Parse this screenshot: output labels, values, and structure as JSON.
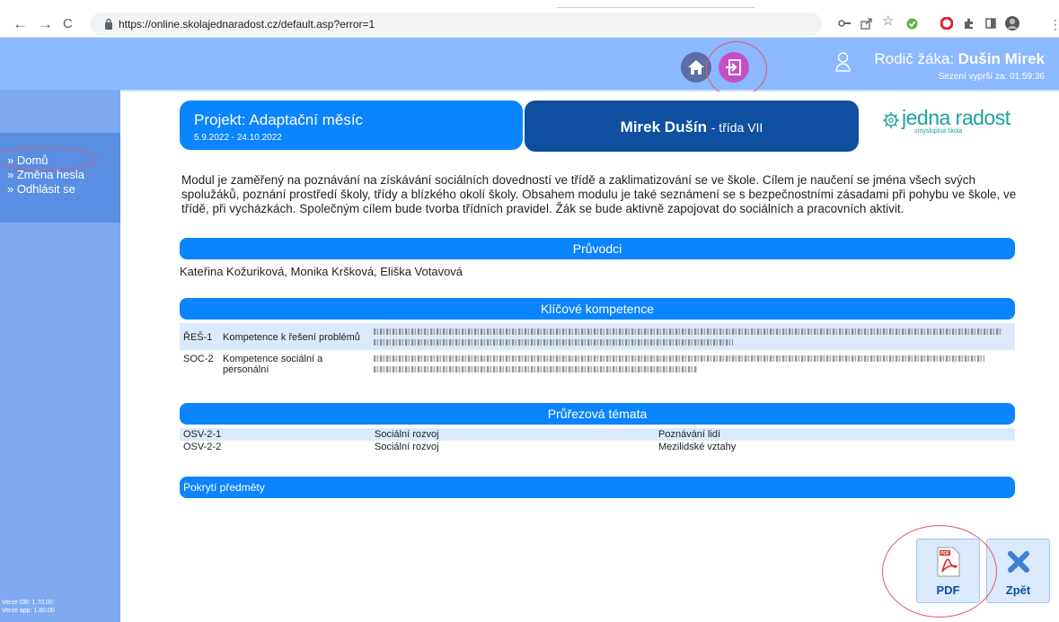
{
  "browser": {
    "url": "https://online.skolajednaradost.cz/default.asp?error=1",
    "back": "←",
    "forward": "→",
    "reload": "C"
  },
  "header": {
    "role_label": "Rodič žáka:",
    "user_name": "Dušin Mirek",
    "session": "Sezení vyprší za: 01:59:36"
  },
  "sidebar": {
    "items": [
      {
        "label": "» Domů"
      },
      {
        "label": "» Změna hesla"
      },
      {
        "label": "» Odhlásit se"
      }
    ],
    "version_db": "Verze DB: 1.70.00",
    "version_app": "Verze app: 1.80.00"
  },
  "project": {
    "title": "Projekt: Adaptační měsíc",
    "dates": "5.9.2022 - 24.10.2022"
  },
  "student": {
    "name": "Mirek Dušín",
    "class": "- třída VII"
  },
  "logo": {
    "name": "jedna radost",
    "tagline": "smysluplná škola"
  },
  "description": "Modul je zaměřený na poznávání na získávání sociálních dovedností ve třídě a zaklimatizování se ve škole. Cílem je naučení se jména všech svých spolužáků, poznání prostředí školy, třídy a blízkého okolí školy. Obsahem modulu je také seznámení se s bezpečnostními zásadami při pohybu ve škole, ve třídě, při vycházkách. Společným cílem bude tvorba třídních pravidel. Žák se bude aktivně zapojovat do sociálních a pracovních aktivit.",
  "guides": {
    "heading": "Průvodci",
    "names": "Kateřina Kožuriková, Monika Kršková, Eliška Votavová"
  },
  "competences": {
    "heading": "Klíčové kompetence",
    "rows": [
      {
        "code": "ŘEŠ-1",
        "name": "Kompetence k řešení problémů"
      },
      {
        "code": "SOC-2",
        "name": "Kompetence sociální a personální"
      }
    ]
  },
  "themes": {
    "heading": "Průřezová témata",
    "rows": [
      {
        "code": "OSV-2-1",
        "area": "Sociální rozvoj",
        "topic": "Poznávání lidí"
      },
      {
        "code": "OSV-2-2",
        "area": "Sociální rozvoj",
        "topic": "Mezilidské vztahy"
      }
    ]
  },
  "subjects": {
    "heading": "Pokrytí předměty"
  },
  "actions": {
    "pdf": "PDF",
    "back": "Zpět",
    "pdf_icon_text": "PDF"
  },
  "colors": {
    "primary": "#0a84ff",
    "dark": "#0f4fa0",
    "sidebar": "#7fa9f0",
    "header": "#8cb8ff",
    "annotation": "#e05a63"
  }
}
